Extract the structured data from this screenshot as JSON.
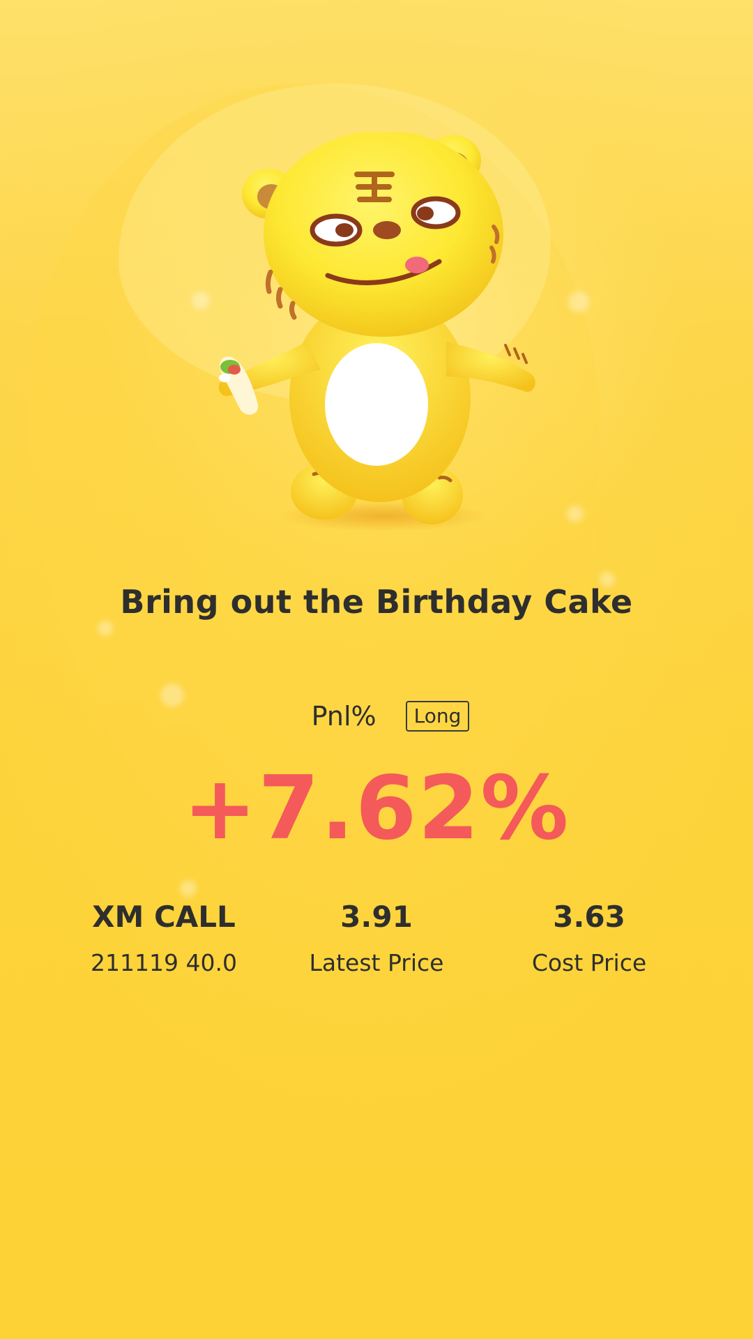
{
  "headline": "Bring out the Birthday Cake",
  "pnl": {
    "label": "Pnl%",
    "position_badge": "Long",
    "value": "+7.62%",
    "value_color": "#f45a5a"
  },
  "stats": {
    "contract": {
      "name": "XM CALL",
      "detail": "211119 40.0"
    },
    "latest_price": {
      "value": "3.91",
      "label": "Latest Price"
    },
    "cost_price": {
      "value": "3.63",
      "label": "Cost Price"
    }
  },
  "colors": {
    "background": "#fdd33b",
    "text": "#2e2e2e",
    "gain": "#f45a5a"
  },
  "mascot": {
    "icon": "tiger-mascot-icon"
  }
}
